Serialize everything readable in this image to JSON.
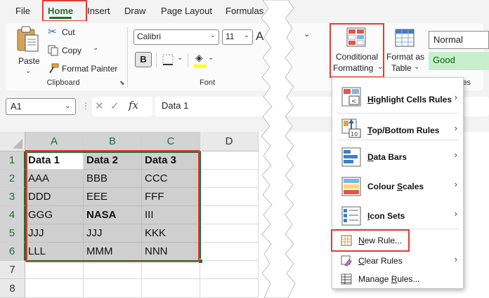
{
  "menu": {
    "items": [
      "File",
      "Home",
      "Insert",
      "Draw",
      "Page Layout",
      "Formulas"
    ],
    "active": "Home"
  },
  "clipboard": {
    "paste_label": "Paste",
    "cut_label": "Cut",
    "copy_label": "Copy",
    "format_painter_label": "Format Painter",
    "group_label": "Clipboard"
  },
  "font": {
    "name": "Calibri",
    "size": "11",
    "bold_label": "B",
    "group_label": "Font"
  },
  "styles": {
    "conditional_formatting_line1": "Conditional",
    "conditional_formatting_line2": "Formatting",
    "format_as_table_line1": "Format as",
    "format_as_table_line2": "Table",
    "normal_label": "Normal",
    "good_label": "Good",
    "group_label_partial": "les",
    "colors": {
      "good_bg": "#c6efce",
      "good_fg": "#006100"
    }
  },
  "formula_bar": {
    "name_box": "A1",
    "fx_label": "fx",
    "content": "Data 1"
  },
  "grid": {
    "columns": [
      "A",
      "B",
      "C",
      "D"
    ],
    "rows": [
      "1",
      "2",
      "3",
      "4",
      "5",
      "6",
      "7",
      "8"
    ],
    "cells": [
      [
        "Data 1",
        "Data 2",
        "Data 3"
      ],
      [
        "AAA",
        "BBB",
        "CCC"
      ],
      [
        "DDD",
        "EEE",
        "FFF"
      ],
      [
        "GGG",
        "NASA",
        "III"
      ],
      [
        "JJJ",
        "JJJ",
        "KKK"
      ],
      [
        "LLL",
        "MMM",
        "NNN"
      ]
    ]
  },
  "cf_menu": {
    "items": [
      {
        "name": "highlight-cells-rules",
        "pre": "",
        "key": "H",
        "post": "ighlight Cells Rules",
        "bold": true,
        "submenu": true
      },
      {
        "name": "top-bottom-rules",
        "pre": "",
        "key": "T",
        "post": "op/Bottom Rules",
        "bold": true,
        "submenu": true
      },
      {
        "name": "data-bars",
        "pre": "",
        "key": "D",
        "post": "ata Bars",
        "bold": true,
        "submenu": true
      },
      {
        "name": "colour-scales",
        "pre": "Colour ",
        "key": "S",
        "post": "cales",
        "bold": true,
        "submenu": true
      },
      {
        "name": "icon-sets",
        "pre": "",
        "key": "I",
        "post": "con Sets",
        "bold": true,
        "submenu": true
      },
      {
        "name": "new-rule",
        "pre": "",
        "key": "N",
        "post": "ew Rule...",
        "bold": false,
        "submenu": false
      },
      {
        "name": "clear-rules",
        "pre": "",
        "key": "C",
        "post": "lear Rules",
        "bold": false,
        "submenu": true
      },
      {
        "name": "manage-rules",
        "pre": "Manage ",
        "key": "R",
        "post": "ules...",
        "bold": false,
        "submenu": false
      }
    ],
    "submenu_arrow": "›"
  },
  "accent": {
    "excel_green": "#1e6e34",
    "highlight_red": "#e53935"
  }
}
